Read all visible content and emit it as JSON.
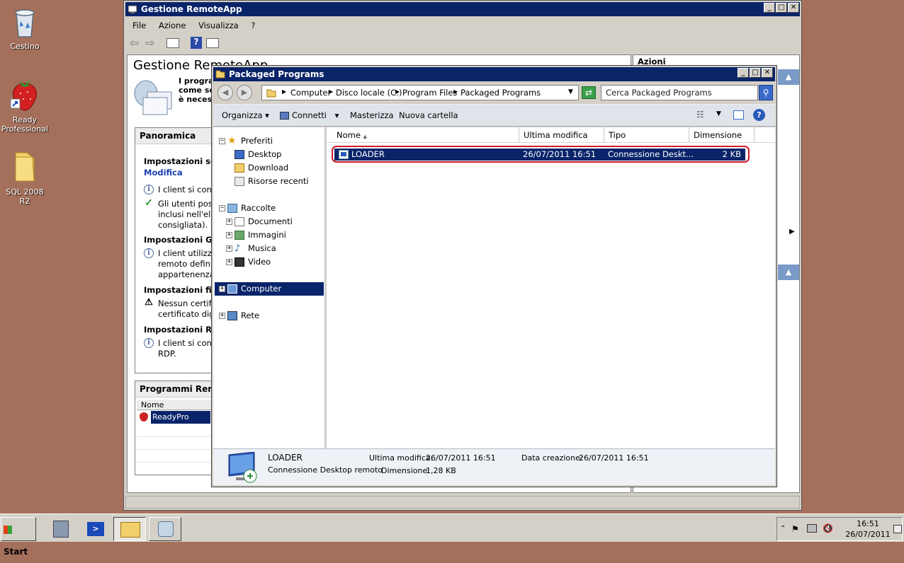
{
  "desktop": {
    "icons": [
      {
        "label": "Cestino",
        "icon": "recycle-bin-icon"
      },
      {
        "label": "Ready Professional",
        "icon": "strawberry-app-icon"
      },
      {
        "label": "SQL 2008 R2",
        "icon": "folder-icon"
      }
    ]
  },
  "outer_window": {
    "title": "Gestione RemoteApp",
    "menu": [
      "File",
      "Azione",
      "Visualizza",
      "?"
    ],
    "heading": "Gestione RemoteApp",
    "intro_lines": [
      "I program",
      "come se",
      "è necess"
    ],
    "actions_title": "Azioni",
    "overview": {
      "title": "Panoramica",
      "server_settings": "Impostazioni serv",
      "modify_link": "Modifica",
      "info1": "I client si conn",
      "check_lines": [
        "Gli utenti poss",
        "inclusi nell'ele",
        "consigliata)."
      ],
      "gateway_title": "Impostazioni Gat",
      "gateway_lines": [
        "I client utilizze",
        "remoto defini",
        "appartenenza."
      ],
      "signature_title": "Impostazioni firm",
      "signature_lines": [
        "Nessun certifi",
        "certificato dig"
      ],
      "rdp_title": "Impostazioni RDI",
      "rdp_lines": [
        "I client si conn",
        "RDP."
      ]
    },
    "programs": {
      "title": "Programmi Remo",
      "column": "Nome",
      "rows": [
        "ReadyPro"
      ]
    }
  },
  "explorer": {
    "title": "Packaged Programs",
    "breadcrumb": [
      "Computer",
      "Disco locale (C:)",
      "Program Files",
      "Packaged Programs"
    ],
    "search_placeholder": "Cerca Packaged Programs",
    "toolbar": {
      "organize": "Organizza",
      "connect": "Connetti",
      "burn": "Masterizza",
      "new_folder": "Nuova cartella"
    },
    "nav": {
      "favorites": "Preferiti",
      "desktop": "Desktop",
      "download": "Download",
      "recent": "Risorse recenti",
      "libraries": "Raccolte",
      "documents": "Documenti",
      "images": "Immagini",
      "music": "Musica",
      "video": "Video",
      "computer": "Computer",
      "network": "Rete"
    },
    "columns": {
      "name": "Nome",
      "modified": "Ultima modifica",
      "type": "Tipo",
      "size": "Dimensione"
    },
    "files": [
      {
        "name": "LOADER",
        "modified": "26/07/2011 16:51",
        "type": "Connessione Deskt...",
        "size": "2 KB"
      }
    ],
    "details": {
      "name": "LOADER",
      "type": "Connessione Desktop remoto",
      "modified_label": "Ultima modifica:",
      "modified_value": "26/07/2011 16:51",
      "size_label": "Dimensione:",
      "size_value": "1,28 KB",
      "created_label": "Data creazione:",
      "created_value": "26/07/2011 16:51"
    }
  },
  "taskbar": {
    "start": "Start",
    "time": "16:51",
    "date": "26/07/2011"
  },
  "colors": {
    "desktop": "#a5705b",
    "titlebar": "#0a246a",
    "selection": "#0a246a",
    "highlight_ring": "#d0182a"
  }
}
